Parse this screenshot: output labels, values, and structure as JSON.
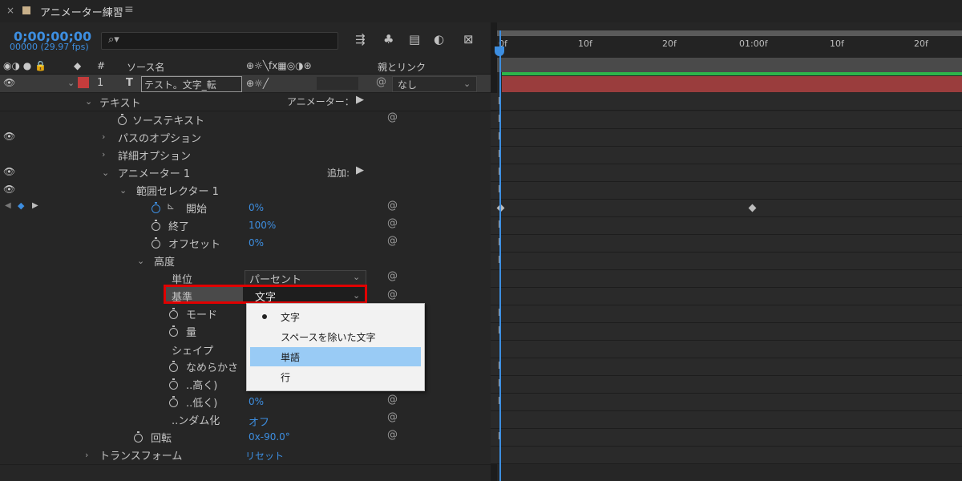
{
  "tab": {
    "close": "×",
    "title": "アニメーター練習",
    "menu": "≡"
  },
  "time": {
    "timecode": "0;00;00;00",
    "frames": "00000 (29.97 fps)"
  },
  "search": {
    "icon": "⌕▾"
  },
  "columns": {
    "icons": "◉◑ ● 🔒",
    "label_icon": "◆",
    "num": "#",
    "source": "ソース名",
    "switches": "⊕☼╲fx▦◎◑⊛",
    "parent": "親とリンク"
  },
  "layer": {
    "num": "1",
    "type": "T",
    "name": "テスト。文字_転",
    "parent": "なし",
    "label_color": "#c43c3c"
  },
  "rows": {
    "text": "テキスト",
    "animator_btn": "アニメーター：",
    "source_text": "ソーステキスト",
    "path_options": "パスのオプション",
    "more_options": "詳細オプション",
    "animator1": "アニメーター 1",
    "add_btn": "追加:",
    "range_selector": "範囲セレクター 1",
    "start": "開始",
    "start_val": "0%",
    "end": "終了",
    "end_val": "100%",
    "offset": "オフセット",
    "offset_val": "0%",
    "advanced": "高度",
    "units": "単位",
    "units_val": "パーセント",
    "based_on": "基準",
    "based_on_val": "文字",
    "mode": "モード",
    "amount": "量",
    "shape": "シェイプ",
    "smoothness": "なめらかさ",
    "ease_high": "..高く)",
    "ease_low": "..低く)",
    "ease_low_val": "0%",
    "randomize": "..ンダム化",
    "randomize_val": "オフ",
    "rotation": "回転",
    "rotation_val": "0x-90.0°",
    "transform": "トランスフォーム",
    "transform_val": "リセット"
  },
  "dropdown": {
    "items": [
      "文字",
      "スペースを除いた文字",
      "単語",
      "行"
    ],
    "checked": "文字",
    "highlighted": "単語"
  },
  "ruler": {
    "ticks": [
      "0f",
      "10f",
      "20f",
      "01:00f",
      "10f",
      "20f"
    ]
  },
  "colors": {
    "accent": "#3d8ee0",
    "highlight": "#e00000",
    "layer_bar": "#9a3d3d",
    "work_area": "#2db54a"
  }
}
